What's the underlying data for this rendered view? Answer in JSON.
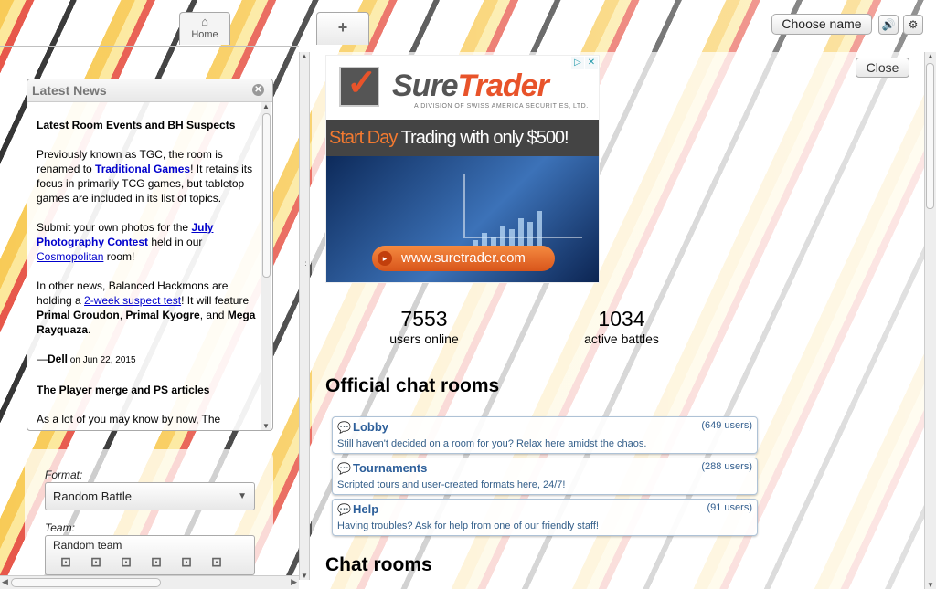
{
  "header": {
    "tabs": [
      {
        "label": "Home",
        "icon": "home-icon"
      },
      {
        "label": "+",
        "icon": "plus-icon"
      }
    ],
    "choose_name_label": "Choose name",
    "volume_icon": "volume-icon",
    "settings_icon": "gear-icon"
  },
  "news": {
    "title": "Latest News",
    "items": [
      {
        "heading": "Latest Room Events and BH Suspects",
        "p1_before": "Previously known as TGC, the room is renamed to ",
        "p1_link": "Traditional Games",
        "p1_after": "! It retains its focus in primarily TCG games, but tabletop games are included in its list of topics.",
        "p2_before": "Submit your own photos for the ",
        "p2_link": "July Photography Contest",
        "p2_mid": " held in our ",
        "p2_link2": "Cosmopolitan",
        "p2_after": " room!",
        "p3_before": "In other news, Balanced Hackmons are holding a ",
        "p3_link": "2-week suspect test",
        "p3_after": "! It will feature ",
        "p3_b1": "Primal Groudon",
        "p3_sep1": ", ",
        "p3_b2": "Primal Kyogre",
        "p3_sep2": ", and ",
        "p3_b3": "Mega Rayquaza",
        "p3_end": ".",
        "sig_dash": "—",
        "sig_author": "Dell",
        "sig_date": " on Jun 22, 2015"
      },
      {
        "heading": "The Player merge and PS articles",
        "p1": "As a lot of you may know by now, The"
      }
    ]
  },
  "battle_form": {
    "format_label": "Format:",
    "format_value": "Random Battle",
    "team_label": "Team:",
    "team_value": "Random team"
  },
  "right": {
    "close_label": "Close",
    "ad": {
      "brand_a": "Sure",
      "brand_b": "Trader",
      "subline": "A DIVISION OF SWISS AMERICA SECURITIES, LTD.",
      "banner_a": "Start Day",
      "banner_b": "Trading",
      "banner_c": " with only $500!",
      "url": "www.suretrader.com"
    },
    "stats": [
      {
        "value": "7553",
        "label": "users online"
      },
      {
        "value": "1034",
        "label": "active battles"
      }
    ],
    "official_heading": "Official chat rooms",
    "rooms": [
      {
        "name": "Lobby",
        "users": "(649 users)",
        "desc": "Still haven't decided on a room for you? Relax here amidst the chaos."
      },
      {
        "name": "Tournaments",
        "users": "(288 users)",
        "desc": "Scripted tours and user-created formats here, 24/7!"
      },
      {
        "name": "Help",
        "users": "(91 users)",
        "desc": "Having troubles? Ask for help from one of our friendly staff!"
      }
    ],
    "chat_heading": "Chat rooms"
  }
}
